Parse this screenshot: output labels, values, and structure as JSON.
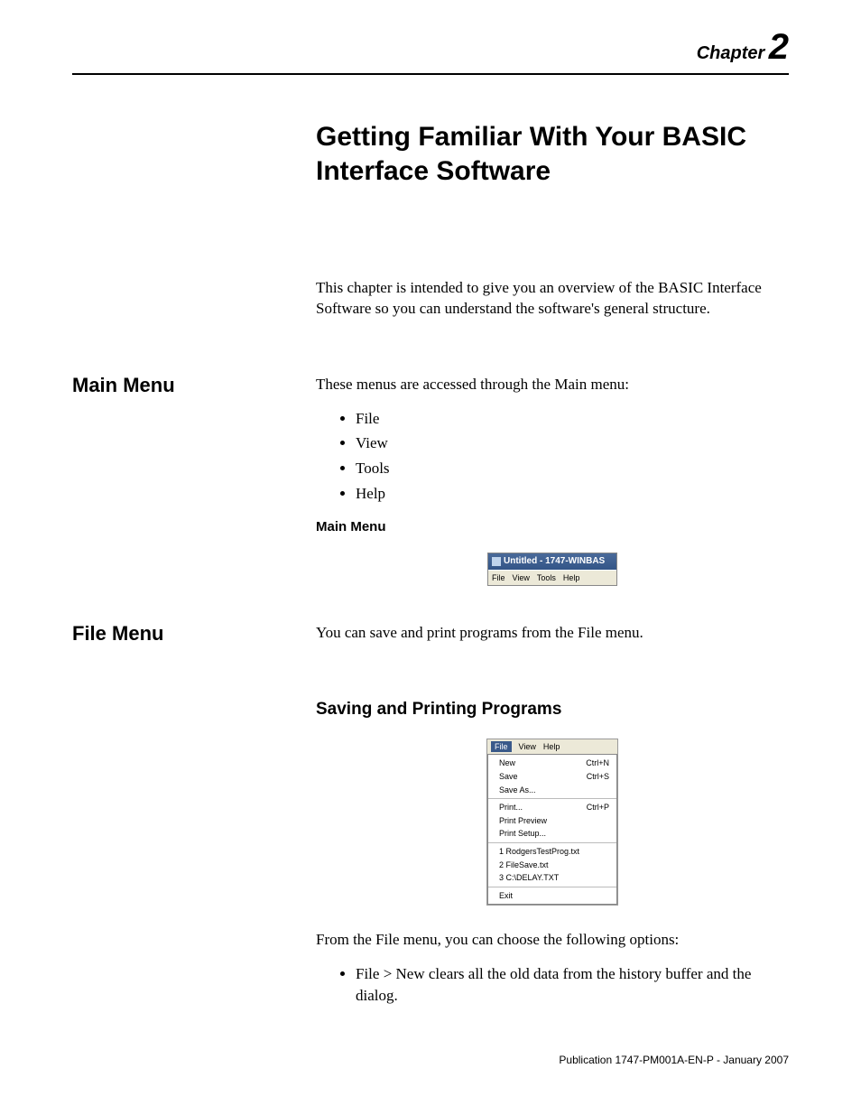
{
  "chapter": {
    "label": "Chapter",
    "number": "2"
  },
  "title": "Getting Familiar With Your BASIC Interface Software",
  "intro": "This chapter is intended to give you an overview of the BASIC Interface Software so you can understand the software's general structure.",
  "mainmenu": {
    "heading": "Main Menu",
    "lead": "These menus are accessed through the Main menu:",
    "items": [
      "File",
      "View",
      "Tools",
      "Help"
    ],
    "caption": "Main Menu",
    "window": {
      "title": "Untitled - 1747-WINBAS",
      "menus": [
        "File",
        "View",
        "Tools",
        "Help"
      ]
    }
  },
  "filemenu": {
    "heading": "File Menu",
    "lead": "You can save and print programs from the File menu.",
    "subheading": "Saving and Printing Programs",
    "topbar": {
      "file": "File",
      "view": "View",
      "help": "Help"
    },
    "groups": [
      [
        {
          "label": "New",
          "shortcut": "Ctrl+N"
        },
        {
          "label": "Save",
          "shortcut": "Ctrl+S"
        },
        {
          "label": "Save As...",
          "shortcut": ""
        }
      ],
      [
        {
          "label": "Print...",
          "shortcut": "Ctrl+P"
        },
        {
          "label": "Print Preview",
          "shortcut": ""
        },
        {
          "label": "Print Setup...",
          "shortcut": ""
        }
      ],
      [
        {
          "label": "1 RodgersTestProg.txt",
          "shortcut": ""
        },
        {
          "label": "2 FileSave.txt",
          "shortcut": ""
        },
        {
          "label": "3 C:\\DELAY.TXT",
          "shortcut": ""
        }
      ],
      [
        {
          "label": "Exit",
          "shortcut": ""
        }
      ]
    ],
    "after": "From the File menu, you can choose the following options:",
    "option1": "File > New clears all the old data from the history buffer and the dialog."
  },
  "footer": "Publication 1747-PM001A-EN-P - January 2007"
}
